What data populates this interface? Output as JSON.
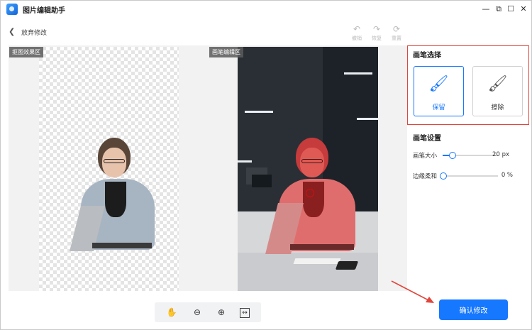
{
  "window": {
    "title": "图片编辑助手",
    "controls": [
      "minimize-icon",
      "restore-icon",
      "maximize-icon",
      "close-icon"
    ]
  },
  "toolbar": {
    "back_label": "放弃修改",
    "history": [
      {
        "icon": "undo-icon",
        "label": "撤销"
      },
      {
        "icon": "redo-icon",
        "label": "恢复"
      },
      {
        "icon": "reset-icon",
        "label": "重置"
      }
    ]
  },
  "canvas": {
    "left_tag": "抠图效果区",
    "right_tag": "画笔编辑区"
  },
  "panel": {
    "brush_select_title": "画笔选择",
    "brush_options": [
      {
        "icon": "brush-add-icon",
        "label": "保留",
        "selected": true
      },
      {
        "icon": "brush-erase-icon",
        "label": "擦除",
        "selected": false
      }
    ],
    "brush_settings_title": "画笔设置",
    "sliders": [
      {
        "label": "画笔大小",
        "value_text": "20 px",
        "fraction": 0.17
      },
      {
        "label": "边缘柔和",
        "value_text": "0 %",
        "fraction": 0.0
      }
    ]
  },
  "zoom_tools": [
    "hand-icon",
    "zoom-out-icon",
    "zoom-in-icon",
    "fit-screen-icon"
  ],
  "confirm_label": "确认修改",
  "colors": {
    "accent": "#1677ff",
    "highlight_border": "#e0463c",
    "mask_overlay": "#e24a4a"
  }
}
